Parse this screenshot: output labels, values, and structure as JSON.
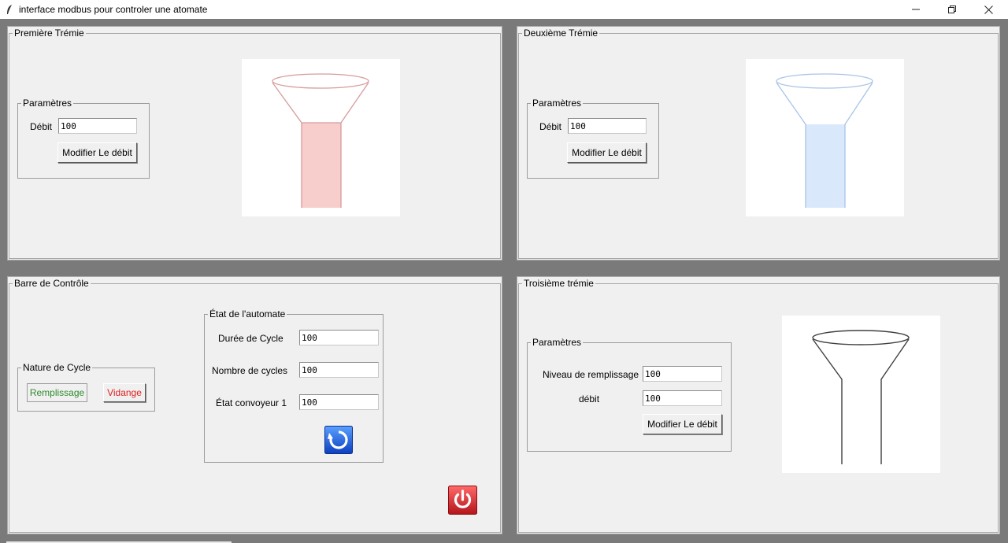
{
  "window": {
    "title": "interface modbus pour controler une atomate"
  },
  "hopper1": {
    "title": "Première Trémie",
    "params_title": "Paramètres",
    "debit_label": "Débit",
    "debit_value": "100",
    "modify_button": "Modifier Le débit",
    "color_outline": "#d79b9b",
    "color_fill": "#f8cecc",
    "fill_level": 1.0
  },
  "hopper2": {
    "title": "Deuxième Trémie",
    "params_title": "Paramètres",
    "debit_label": "Débit",
    "debit_value": "100",
    "modify_button": "Modifier Le débit",
    "color_outline": "#a8c4e6",
    "color_fill": "#dae8fc",
    "fill_level": 1.0
  },
  "control": {
    "title": "Barre de Contrôle",
    "cycle_title": "Nature de Cycle",
    "fill_button": "Remplissage",
    "drain_button": "Vidange",
    "fill_color": "#2e8b2e",
    "drain_color": "#e02020",
    "state_title": "État de l'automate",
    "cycle_duration_label": "Durée  de Cycle",
    "cycle_duration_value": "100",
    "cycle_count_label": "Nombre de cycles",
    "cycle_count_value": "100",
    "conveyor_label": "État convoyeur 1",
    "conveyor_value": "100"
  },
  "hopper3": {
    "title": "Troisième trémie",
    "params_title": "Paramètres",
    "level_label": "Niveau de remplissage",
    "level_value": "100",
    "debit_label": "débit",
    "debit_value": "100",
    "modify_button": "Modifier Le débit",
    "color_outline": "#404040"
  },
  "icons": {
    "refresh": "refresh-icon",
    "power": "power-icon",
    "refresh_color": "#1a5fd6",
    "power_color": "#d9262b"
  }
}
